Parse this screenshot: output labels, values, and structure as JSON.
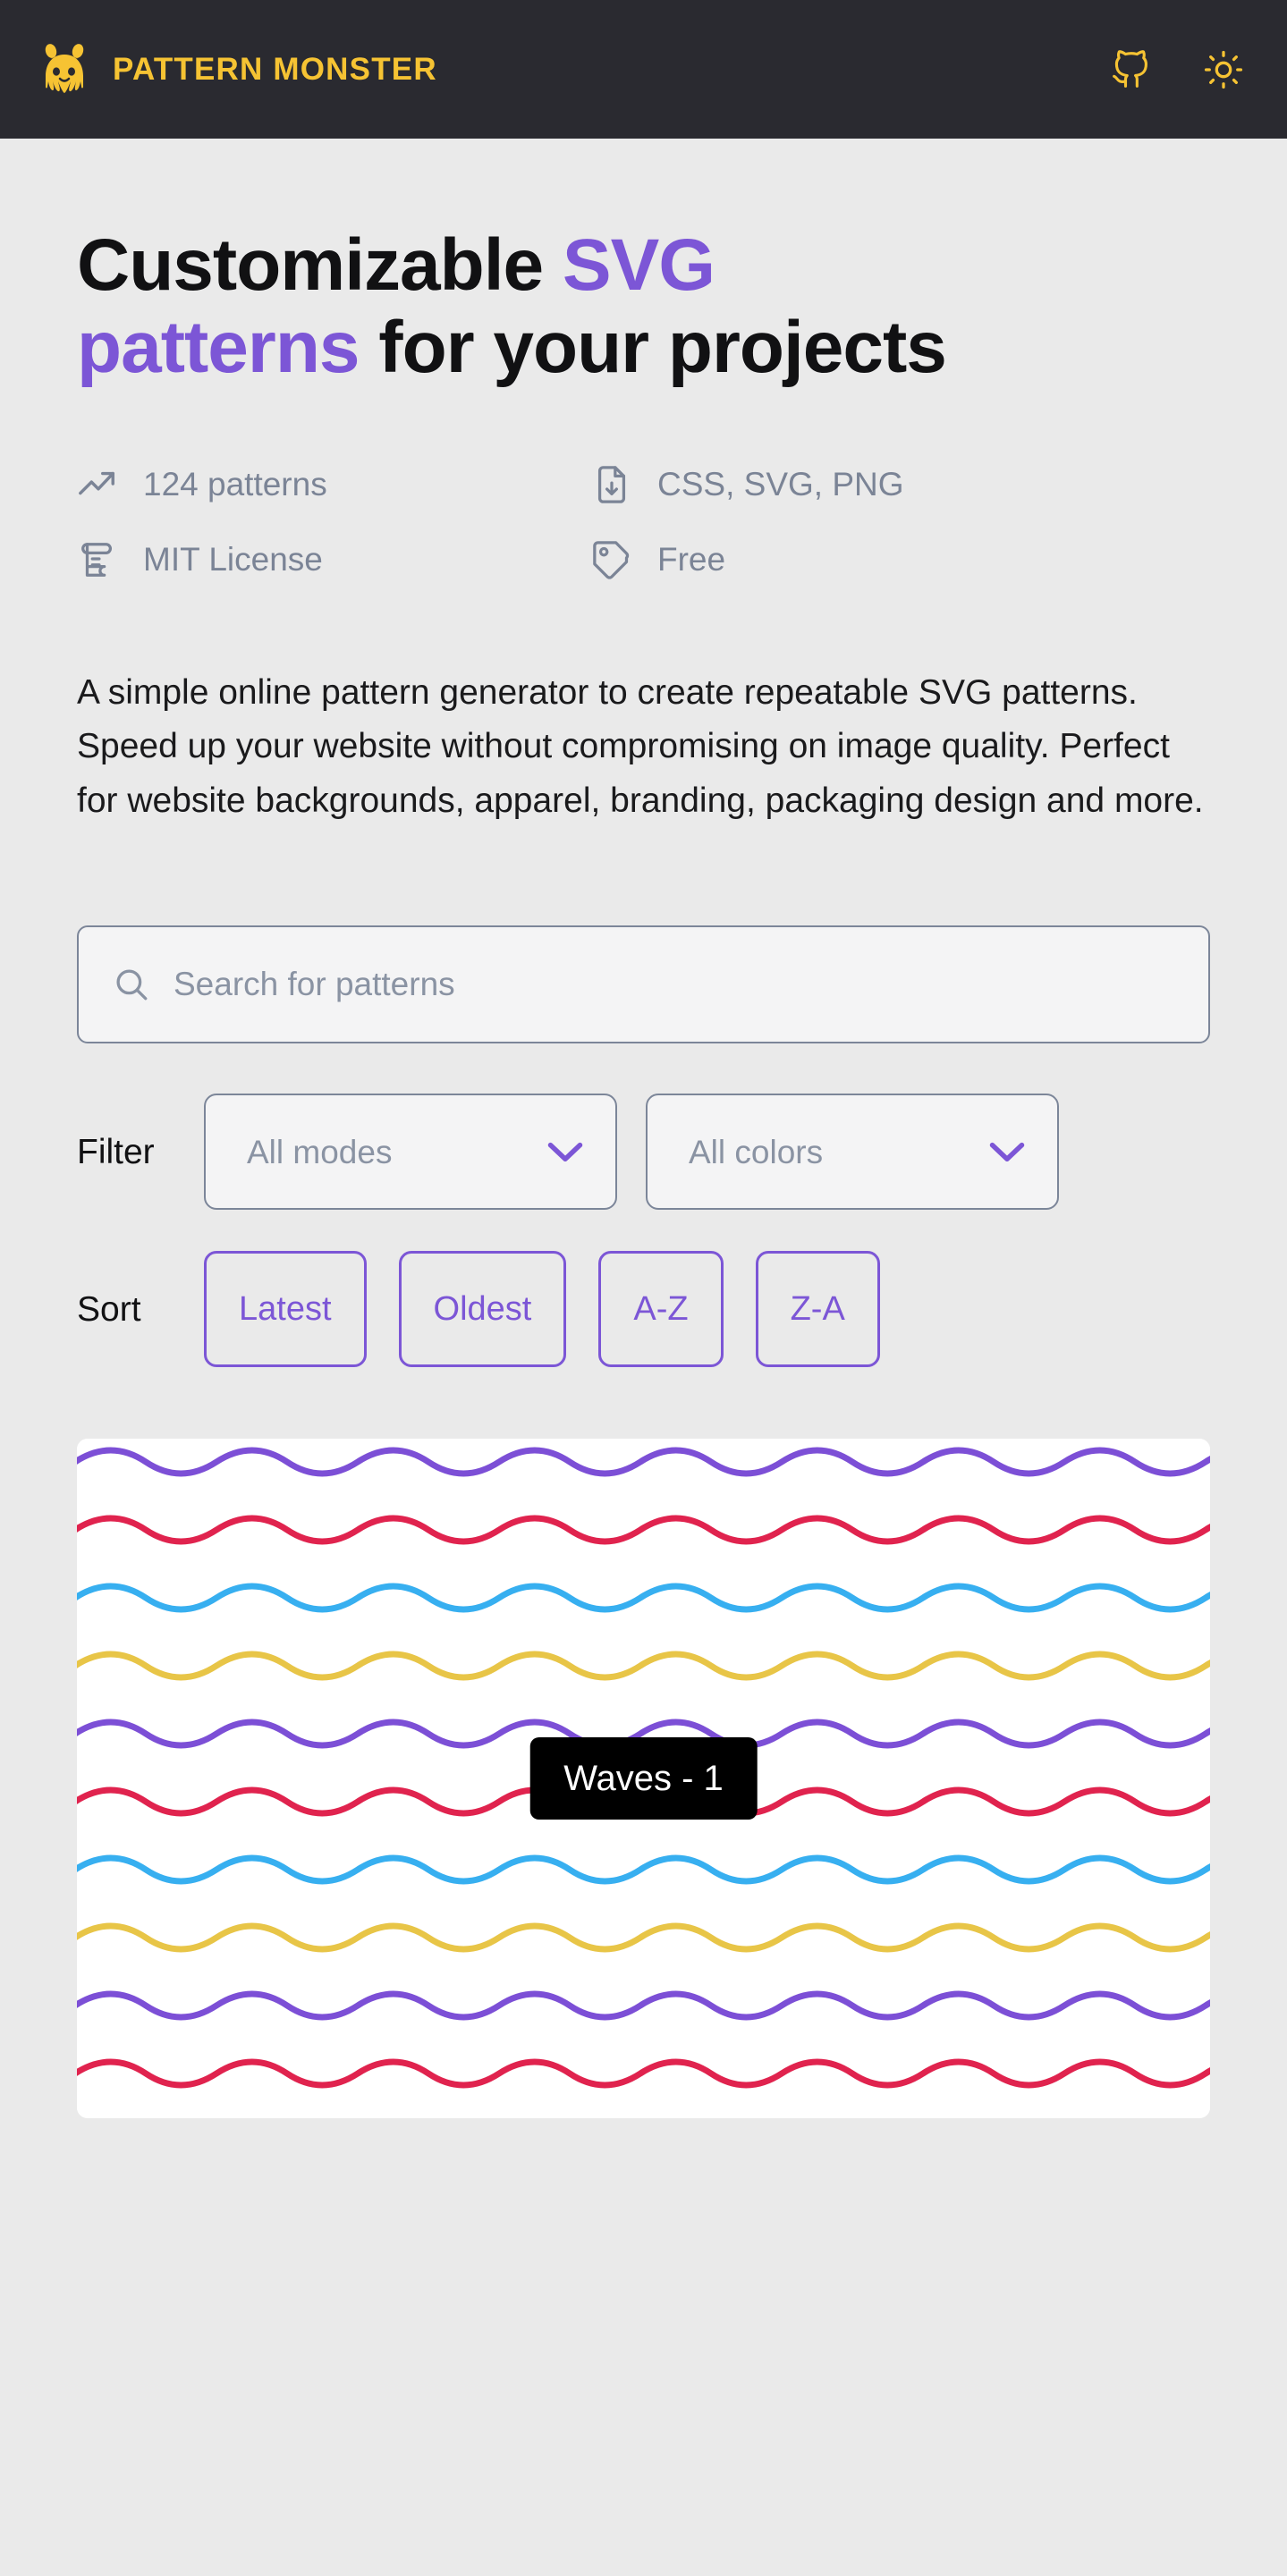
{
  "header": {
    "brand_name": "PATTERN MONSTER",
    "logo_icon": "monster-logo-icon",
    "github_icon": "github-icon",
    "theme_icon": "sun-icon",
    "background_color": "#2a2a30",
    "brand_color": "#f6c333"
  },
  "hero": {
    "title_part1": "Customizable ",
    "title_accent1": "SVG patterns",
    "title_part2": " for your projects",
    "accent_color": "#7c56d6",
    "description": "A simple online pattern generator to create repeatable SVG patterns. Speed up your website without compromising on image quality. Perfect for website backgrounds, apparel, branding, packaging design and more."
  },
  "stats": [
    {
      "icon": "trending-up-icon",
      "label": "124 patterns"
    },
    {
      "icon": "file-download-icon",
      "label": "CSS, SVG, PNG"
    },
    {
      "icon": "license-scroll-icon",
      "label": "MIT License"
    },
    {
      "icon": "tag-icon",
      "label": "Free"
    }
  ],
  "search": {
    "icon": "search-icon",
    "placeholder": "Search for patterns",
    "value": ""
  },
  "filter": {
    "label": "Filter",
    "selects": [
      {
        "name": "modes",
        "value": "All modes",
        "chevron": "chevron-down-icon"
      },
      {
        "name": "colors",
        "value": "All colors",
        "chevron": "chevron-down-icon"
      }
    ]
  },
  "sort": {
    "label": "Sort",
    "buttons": [
      "Latest",
      "Oldest",
      "A-Z",
      "Z-A"
    ]
  },
  "patterns": [
    {
      "name": "Waves - 1",
      "background": "#ffffff",
      "stroke_colors": [
        "#7c4fd6",
        "#e0234e",
        "#37aff0",
        "#e8c547"
      ]
    }
  ]
}
